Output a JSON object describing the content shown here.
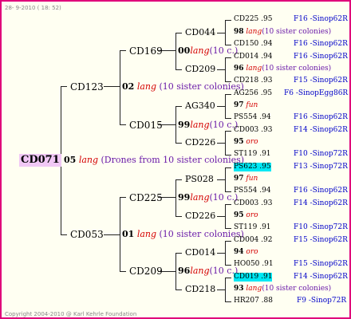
{
  "header": {
    "date": "28- 9-2010 ( 18: 52)"
  },
  "footer": {
    "copyright": "Copyright 2004-2010 @ Karl Kehrle Foundation"
  },
  "tree": {
    "root": "CD071",
    "root_label": {
      "num": "05",
      "lang": "lang",
      "note": "(Drones from 10 sister colonies)"
    },
    "l1": [
      {
        "name": "CD123",
        "num": "02",
        "lang": "lang",
        "note": "(10 sister colonies)"
      },
      {
        "name": "CD053",
        "num": "01",
        "lang": "lang",
        "note": "(10 sister colonies)"
      }
    ],
    "l2": [
      {
        "name": "CD169",
        "num": "00",
        "lang": "lang",
        "note": "(10 c.)"
      },
      {
        "name": "CD015",
        "num": "99",
        "lang": "lang",
        "note": "(10 c.)"
      },
      {
        "name": "CD225",
        "num": "99",
        "lang": "lang",
        "note": "(10 c.)"
      },
      {
        "name": "CD209",
        "num": "96",
        "lang": "lang",
        "note": "(10 c.)"
      }
    ],
    "l3": [
      {
        "name": "CD044",
        "num": "98",
        "lang": "lang",
        "note": "(10 sister colonies)"
      },
      {
        "name": "CD209",
        "num": "96",
        "lang": "lang",
        "note": "(10 sister colonies)"
      },
      {
        "name": "AG340",
        "num": "97",
        "lang": "fun",
        "note": ""
      },
      {
        "name": "CD226",
        "num": "95",
        "lang": "oro",
        "note": ""
      },
      {
        "name": "PS028",
        "num": "97",
        "lang": "fun",
        "note": ""
      },
      {
        "name": "CD226",
        "num": "95",
        "lang": "oro",
        "note": ""
      },
      {
        "name": "CD014",
        "num": "94",
        "lang": "oro",
        "note": ""
      },
      {
        "name": "CD218",
        "num": "93",
        "lang": "lang",
        "note": "(10 sister colonies)"
      }
    ],
    "leaves": [
      {
        "id": "CD225 .95",
        "tag": "F16 -Sinop62R"
      },
      {
        "id": "CD150 .94",
        "tag": "F16 -Sinop62R"
      },
      {
        "id": "CD014 .94",
        "tag": "F16 -Sinop62R"
      },
      {
        "id": "CD218 .93",
        "tag": "F15 -Sinop62R"
      },
      {
        "id": "AG256 .95",
        "tag": "F6 -SinopEgg86R"
      },
      {
        "id": "PS554 .94",
        "tag": "F16 -Sinop62R"
      },
      {
        "id": "CD003 .93",
        "tag": "F14 -Sinop62R"
      },
      {
        "id": "ST119 .91",
        "tag": "F10 -Sinop72R"
      },
      {
        "id": "PS623 .95",
        "tag": "F13 -Sinop72R"
      },
      {
        "id": "PS554 .94",
        "tag": "F16 -Sinop62R"
      },
      {
        "id": "CD003 .93",
        "tag": "F14 -Sinop62R"
      },
      {
        "id": "ST119 .91",
        "tag": "F10 -Sinop72R"
      },
      {
        "id": "CD004 .92",
        "tag": "F15 -Sinop62R"
      },
      {
        "id": "HO050 .91",
        "tag": "F15 -Sinop62R"
      },
      {
        "id": "CD019 .91",
        "tag": "F14 -Sinop62R"
      },
      {
        "id": "HR207 .88",
        "tag": "F9 -Sinop72R"
      }
    ]
  },
  "colors": {
    "border": "#e0007a",
    "root_bg": "#f1c8f5",
    "highlight": "#00e8f4",
    "lang": "#d40000",
    "note": "#6a1aa8",
    "tag": "#0000c8"
  }
}
